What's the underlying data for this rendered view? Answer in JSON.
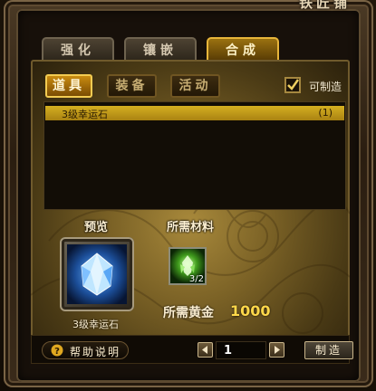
{
  "window": {
    "title": "铁匠铺"
  },
  "tabs": [
    {
      "label": "强化",
      "active": false
    },
    {
      "label": "镶嵌",
      "active": false
    },
    {
      "label": "合成",
      "active": true
    }
  ],
  "subtabs": [
    {
      "label": "道具",
      "active": true
    },
    {
      "label": "装备",
      "active": false
    },
    {
      "label": "活动",
      "active": false
    }
  ],
  "filter": {
    "label": "可制造",
    "checked": true
  },
  "list": {
    "items": [
      {
        "name": "3级幸运石",
        "count": "(1)",
        "selected": true
      }
    ]
  },
  "preview": {
    "label": "预览",
    "item_name": "3级幸运石",
    "icon": "blue-crystal-icon"
  },
  "materials": {
    "label": "所需材料",
    "items": [
      {
        "icon": "green-crystal-icon",
        "count": "3/2"
      }
    ]
  },
  "gold": {
    "label": "所需黄金",
    "value": "1000"
  },
  "footer": {
    "help_label": "帮助说明",
    "quantity": "1",
    "make_label": "制造"
  },
  "colors": {
    "accent_gold": "#e7b53a",
    "gold_value": "#ffd84a",
    "selected_row": "#d5b021"
  }
}
